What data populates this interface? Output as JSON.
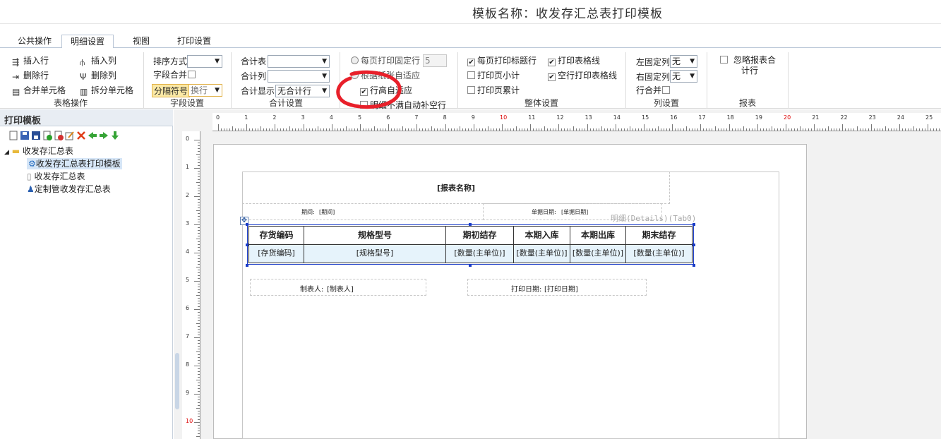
{
  "window_title": "模板名称：收发存汇总表打印模板",
  "tabs": [
    "公共操作",
    "明细设置",
    "视图",
    "打印设置"
  ],
  "ribbon": {
    "table_ops": {
      "insert_row": "插入行",
      "insert_col": "插入列",
      "delete_row": "删除行",
      "delete_col": "删除列",
      "merge_cells": "合并单元格",
      "split_cells": "拆分单元格",
      "title": "表格操作"
    },
    "field": {
      "sort_label": "排序方式",
      "sort_value": "",
      "field_merge": "字段合并",
      "separator_label": "分隔符号",
      "separator_value": "换行",
      "title": "字段设置"
    },
    "total": {
      "total_table": "合计表",
      "total_col": "合计列",
      "total_display": "合计显示",
      "total_display_value": "无合计行",
      "title": "合计设置"
    },
    "rows": {
      "fixed_rows": "每页打印固定行",
      "fixed_rows_value": "5",
      "paper_adapt": "根据纸张自适应",
      "row_height_adapt": "行高自适应",
      "fill_blank": "明细不满自动补空行"
    },
    "overall": {
      "title_each_page": "每页打印标题行",
      "print_grid": "打印表格线",
      "page_subtotal": "打印页小计",
      "blank_row_grid": "空行打印表格线",
      "page_cumulative": "打印页累计",
      "title": "整体设置"
    },
    "cols": {
      "left_fixed": "左固定列",
      "left_fixed_value": "无",
      "right_fixed": "右固定列",
      "right_fixed_value": "无",
      "row_merge": "行合并",
      "title": "列设置"
    },
    "report": {
      "ignore_total": "忽略报表合计行",
      "title": "报表"
    }
  },
  "left_panel": {
    "header": "打印模板",
    "tree": {
      "root": "收发存汇总表",
      "items": [
        "收发存汇总表打印模板",
        "收发存汇总表",
        "定制管收发存汇总表"
      ]
    }
  },
  "ruler": {
    "h": [
      "0",
      "1",
      "2",
      "3",
      "4",
      "5",
      "6",
      "7",
      "8",
      "9",
      "10",
      "11",
      "12",
      "13",
      "14",
      "15",
      "16",
      "17",
      "18",
      "19",
      "20",
      "21",
      "22",
      "23",
      "24",
      "25"
    ],
    "v": [
      "0",
      "1",
      "2",
      "3",
      "4",
      "5",
      "6",
      "7",
      "8",
      "9",
      "10"
    ]
  },
  "report": {
    "name_field": "[报表名称]",
    "period_label": "期间:",
    "period_value": "[期间]",
    "doc_date_label": "单据日期:",
    "doc_date_value": "[单据日期]",
    "detail_label": "明细(Details)(Tab0)",
    "headers": [
      "存货编码",
      "规格型号",
      "期初结存",
      "本期入库",
      "本期出库",
      "期末结存"
    ],
    "row": [
      "[存货编码]",
      "[规格型号]",
      "[数量(主单位)]",
      "[数量(主单位)]",
      "[数量(主单位)]",
      "[数量(主单位)]"
    ],
    "maker_label": "制表人:",
    "maker_value": "[制表人]",
    "print_date_label": "打印日期:",
    "print_date_value": "[打印日期]"
  },
  "colors": {
    "ribbon_border": "#b9c6d6",
    "detail_row": "#e6f3fb",
    "annotation": "#e8202a",
    "selection": "#1a3cc8"
  }
}
